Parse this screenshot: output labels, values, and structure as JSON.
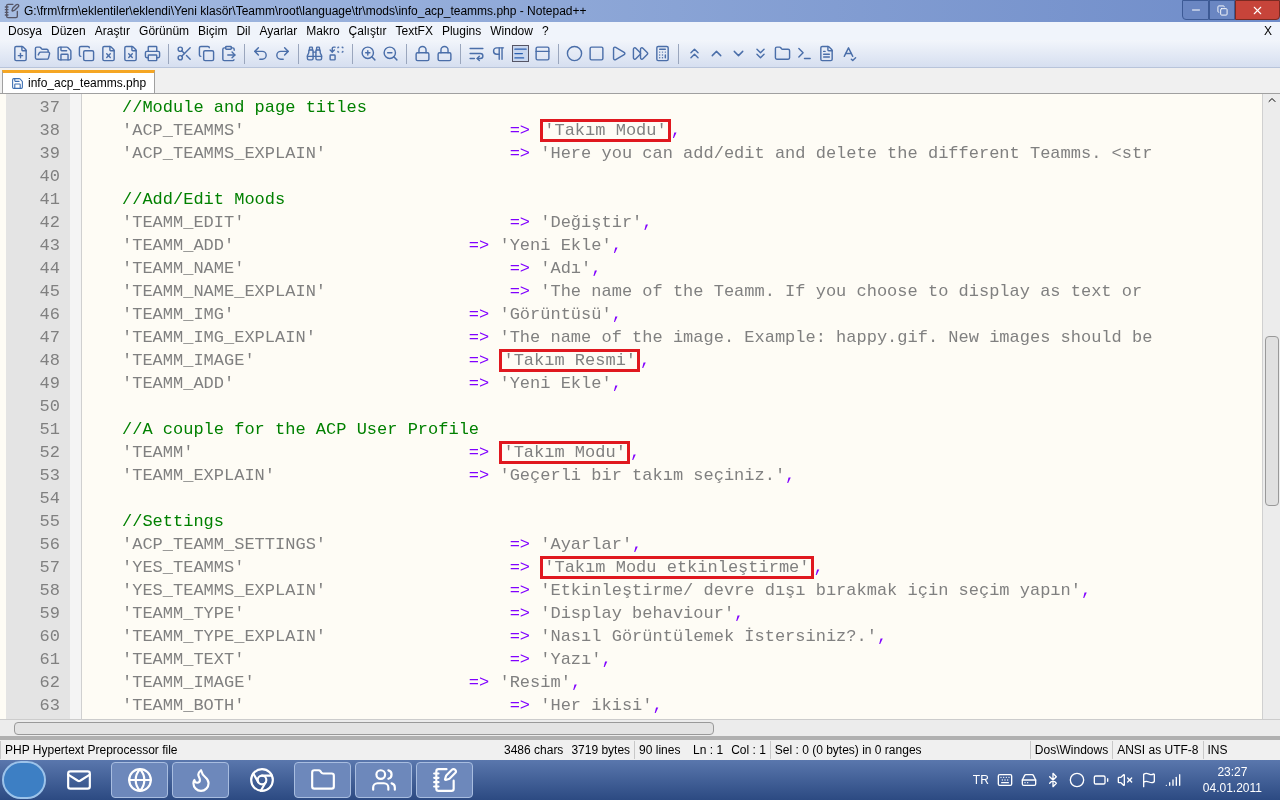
{
  "window": {
    "title": "G:\\frm\\frm\\eklentiler\\eklendi\\Yeni klasör\\Teamm\\root\\language\\tr\\mods\\info_acp_teamms.php - Notepad++"
  },
  "menu": [
    "Dosya",
    "Düzen",
    "Araştır",
    "Görünüm",
    "Biçim",
    "Dil",
    "Ayarlar",
    "Makro",
    "Çalıştır",
    "TextFX",
    "Plugins",
    "Window",
    "?"
  ],
  "menu_close": "X",
  "tabs": [
    {
      "label": "info_acp_teamms.php",
      "selected": true
    }
  ],
  "editor": {
    "lines": [
      {
        "number": "37",
        "kind": "comment",
        "text": "//Module and page titles"
      },
      {
        "number": "38",
        "kind": "entry",
        "key": "'ACP_TEAMMS'",
        "wide_gap": true,
        "arrow": "=>",
        "value": "'Takım Modu'",
        "comma": ",",
        "boxed": true
      },
      {
        "number": "39",
        "kind": "entry",
        "key": "'ACP_TEAMMS_EXPLAIN'",
        "wide_gap": true,
        "arrow": "=>",
        "value": "'Here you can add/edit and delete the different Teamms. <str",
        "boxed": false
      },
      {
        "number": "40",
        "kind": "blank"
      },
      {
        "number": "41",
        "kind": "comment",
        "text": "//Add/Edit Moods"
      },
      {
        "number": "42",
        "kind": "entry",
        "key": "'TEAMM_EDIT'",
        "wide_gap": true,
        "arrow": "=>",
        "value": "'Değiştir'",
        "comma": ",",
        "boxed": false
      },
      {
        "number": "43",
        "kind": "entry",
        "key": "'TEAMM_ADD'",
        "wide_gap": false,
        "arrow": "=>",
        "value": "'Yeni Ekle'",
        "comma": ",",
        "boxed": false
      },
      {
        "number": "44",
        "kind": "entry",
        "key": "'TEAMM_NAME'",
        "wide_gap": true,
        "arrow": "=>",
        "value": "'Adı'",
        "comma": ",",
        "boxed": false
      },
      {
        "number": "45",
        "kind": "entry",
        "key": "'TEAMM_NAME_EXPLAIN'",
        "wide_gap": true,
        "arrow": "=>",
        "value": "'The name of the Teamm. If you choose to display as text or",
        "boxed": false
      },
      {
        "number": "46",
        "kind": "entry",
        "key": "'TEAMM_IMG'",
        "wide_gap": false,
        "arrow": "=>",
        "value": "'Görüntüsü'",
        "comma": ",",
        "boxed": false
      },
      {
        "number": "47",
        "kind": "entry",
        "key": "'TEAMM_IMG_EXPLAIN'",
        "wide_gap": false,
        "arrow": "=>",
        "value": "'The name of the image. Example: happy.gif. New images should be",
        "boxed": false
      },
      {
        "number": "48",
        "kind": "entry",
        "key": "'TEAMM_IMAGE'",
        "wide_gap": false,
        "arrow": "=>",
        "value": "'Takım Resmi'",
        "comma": ",",
        "boxed": true
      },
      {
        "number": "49",
        "kind": "entry",
        "key": "'TEAMM_ADD'",
        "wide_gap": false,
        "arrow": "=>",
        "value": "'Yeni Ekle'",
        "comma": ",",
        "boxed": false
      },
      {
        "number": "50",
        "kind": "blank"
      },
      {
        "number": "51",
        "kind": "comment",
        "text": "//A couple for the ACP User Profile"
      },
      {
        "number": "52",
        "kind": "entry",
        "key": "'TEAMM'",
        "wide_gap": false,
        "arrow": "=>",
        "value": "'Takım Modu'",
        "comma": ",",
        "boxed": true
      },
      {
        "number": "53",
        "kind": "entry",
        "key": "'TEAMM_EXPLAIN'",
        "wide_gap": false,
        "arrow": "=>",
        "value": "'Geçerli bir takım seçiniz.'",
        "comma": ",",
        "boxed": false
      },
      {
        "number": "54",
        "kind": "blank"
      },
      {
        "number": "55",
        "kind": "comment",
        "text": "//Settings"
      },
      {
        "number": "56",
        "kind": "entry",
        "key": "'ACP_TEAMM_SETTINGS'",
        "wide_gap": true,
        "arrow": "=>",
        "value": "'Ayarlar'",
        "comma": ",",
        "boxed": false
      },
      {
        "number": "57",
        "kind": "entry",
        "key": "'YES_TEAMMS'",
        "wide_gap": true,
        "arrow": "=>",
        "value": "'Takım Modu etkinleştirme'",
        "comma": ",",
        "boxed": true
      },
      {
        "number": "58",
        "kind": "entry",
        "key": "'YES_TEAMMS_EXPLAIN'",
        "wide_gap": true,
        "arrow": "=>",
        "value": "'Etkinleştirme/ devre dışı bırakmak için seçim yapın'",
        "comma": ",",
        "boxed": false
      },
      {
        "number": "59",
        "kind": "entry",
        "key": "'TEAMM_TYPE'",
        "wide_gap": true,
        "arrow": "=>",
        "value": "'Display behaviour'",
        "comma": ",",
        "boxed": false
      },
      {
        "number": "60",
        "kind": "entry",
        "key": "'TEAMM_TYPE_EXPLAIN'",
        "wide_gap": true,
        "arrow": "=>",
        "value": "'Nasıl Görüntülemek İstersiniz?.'",
        "comma": ",",
        "boxed": false
      },
      {
        "number": "61",
        "kind": "entry",
        "key": "'TEAMM_TEXT'",
        "wide_gap": true,
        "arrow": "=>",
        "value": "'Yazı'",
        "comma": ",",
        "boxed": false
      },
      {
        "number": "62",
        "kind": "entry",
        "key": "'TEAMM_IMAGE'",
        "wide_gap": false,
        "arrow": "=>",
        "value": "'Resim'",
        "comma": ",",
        "boxed": false
      },
      {
        "number": "63",
        "kind": "entry",
        "key": "'TEAMM_BOTH'",
        "wide_gap": true,
        "arrow": "=>",
        "value": "'Her ikisi'",
        "comma": ",",
        "boxed": false
      }
    ]
  },
  "status_bar": [
    "PHP Hypertext Preprocessor file",
    "3486 chars",
    "3719 bytes",
    "90 lines",
    "Ln : 1",
    "Col : 1",
    "Sel : 0 (0 bytes) in 0 ranges",
    "Dos\\Windows",
    "ANSI as UTF-8",
    "INS"
  ],
  "tray": {
    "language": "TR",
    "time": "23:27",
    "date": "04.01.2011"
  }
}
